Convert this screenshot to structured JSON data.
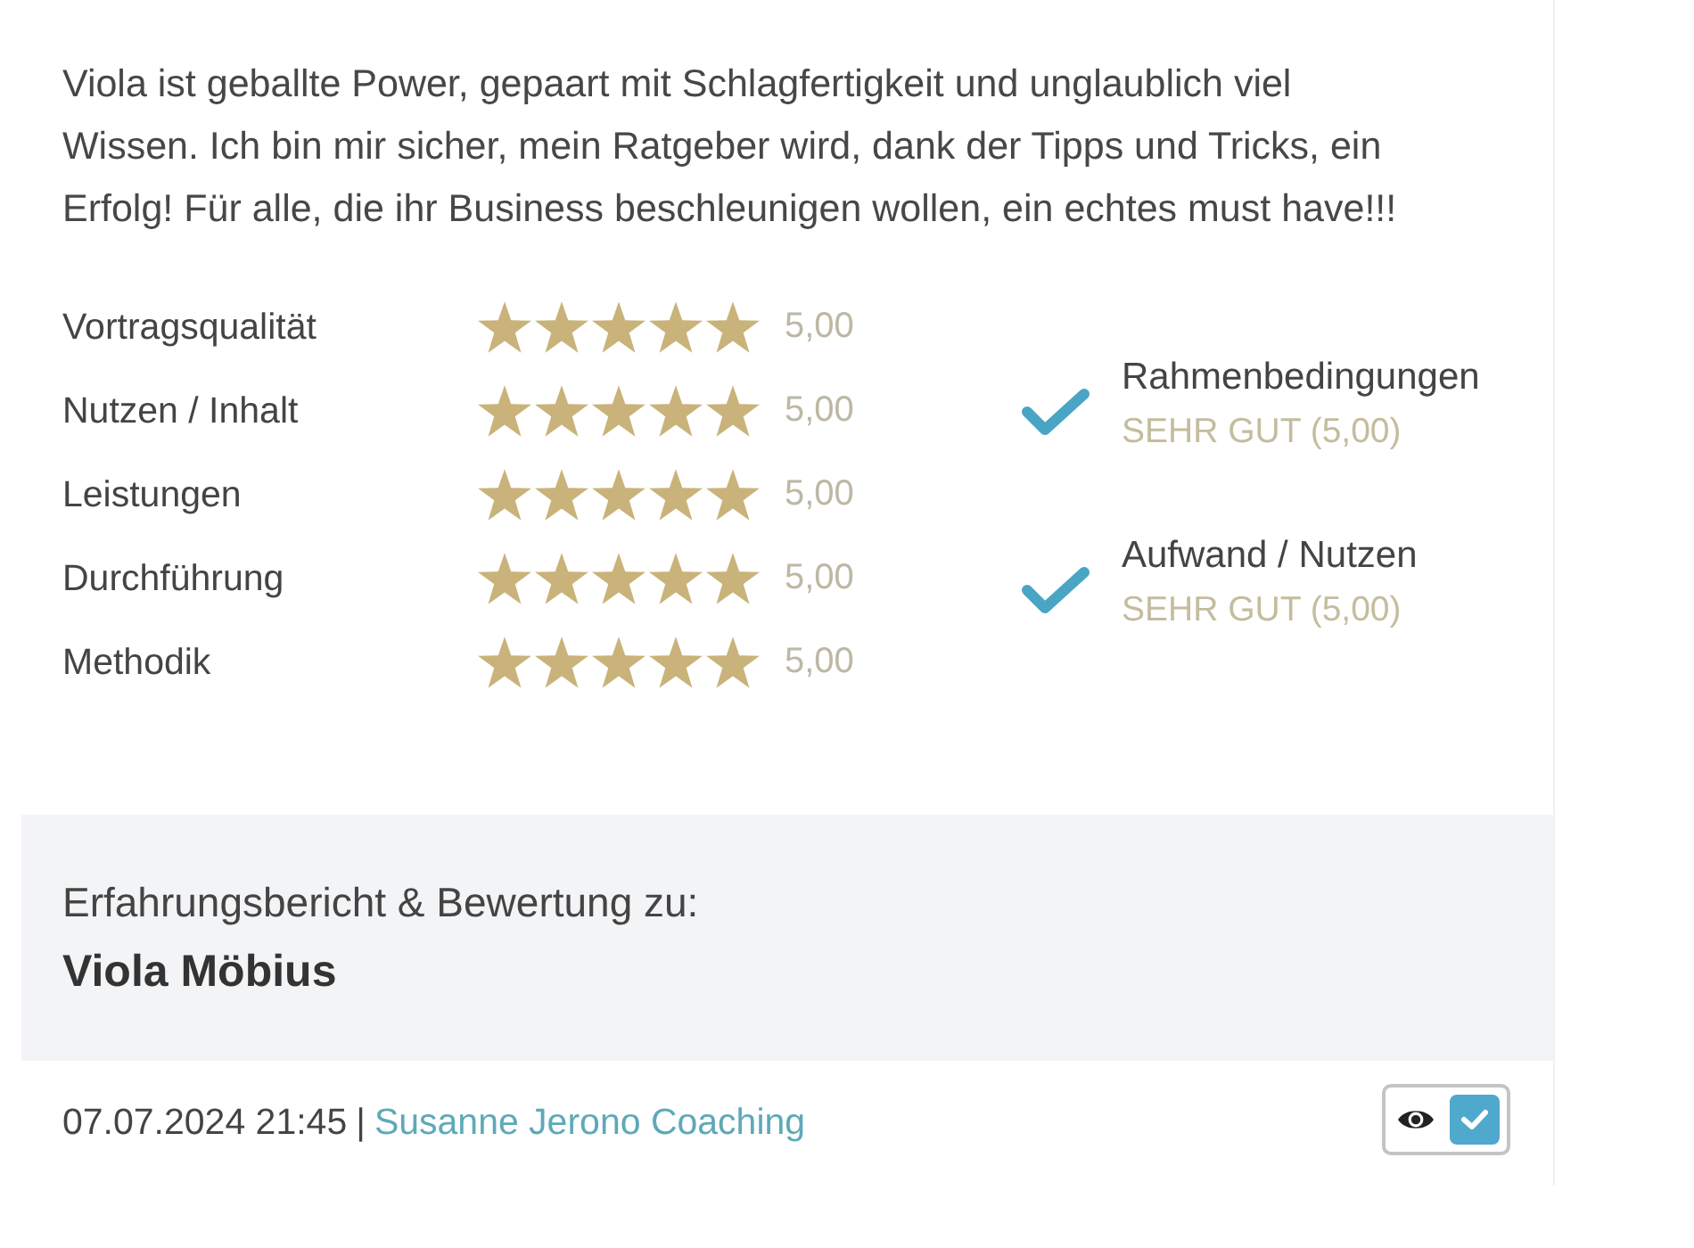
{
  "review": {
    "text": "Viola ist geballte Power, gepaart mit Schlagfertigkeit und unglaublich viel Wissen. Ich bin mir sicher, mein Ratgeber wird, dank der Tipps und Tricks, ein Erfolg! Für alle, die ihr Business beschleunigen wollen, ein echtes must have!!!"
  },
  "ratings": [
    {
      "label": "Vortragsqualität",
      "stars": 5,
      "value": "5,00"
    },
    {
      "label": "Nutzen / Inhalt",
      "stars": 5,
      "value": "5,00"
    },
    {
      "label": "Leistungen",
      "stars": 5,
      "value": "5,00"
    },
    {
      "label": "Durchführung",
      "stars": 5,
      "value": "5,00"
    },
    {
      "label": "Methodik",
      "stars": 5,
      "value": "5,00"
    }
  ],
  "criteria": [
    {
      "label": "Rahmenbedingungen",
      "verdict": "SEHR GUT (5,00)",
      "checked": true
    },
    {
      "label": "Aufwand / Nutzen",
      "verdict": "SEHR GUT (5,00)",
      "checked": true
    }
  ],
  "subject": {
    "heading": "Erfahrungsbericht & Bewertung zu:",
    "name": "Viola Möbius"
  },
  "footer": {
    "timestamp": "07.07.2024 21:45",
    "separator": "|",
    "author": "Susanne Jerono Coaching",
    "approved": {
      "checked": true
    }
  }
}
